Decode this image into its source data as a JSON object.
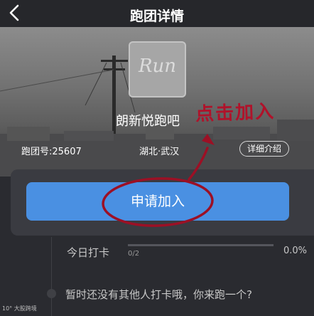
{
  "nav": {
    "title": "跑团详情",
    "back_icon": "chevron-left-icon"
  },
  "club": {
    "logo_text": "Run",
    "name": "朗新悦跑吧",
    "id_text": "跑团号:25607",
    "location": "湖北·武汉",
    "detail_label": "详细介绍"
  },
  "join": {
    "apply_label": "申请加入",
    "accent": "#4a90e2"
  },
  "checkin": {
    "label": "今日打卡",
    "count": "0/2",
    "percent": "0.0%",
    "progress": 0.0
  },
  "feed": {
    "empty_message": "暂时还没有其他人打卡哦，你来跑一个?"
  },
  "annotation": {
    "text": "点击加入",
    "color": "#b0122a"
  },
  "watermark": {
    "text": "10° 大股跨境"
  }
}
